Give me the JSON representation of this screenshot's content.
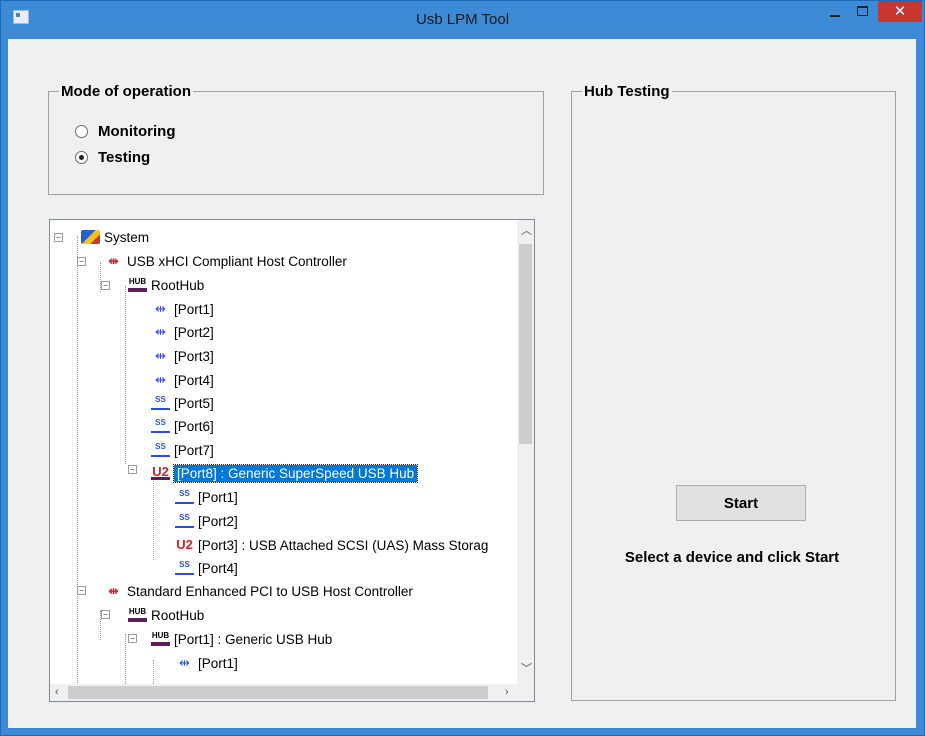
{
  "window": {
    "title": "Usb LPM Tool",
    "close_glyph": "✕",
    "titlebar_color": "#3d8ad6",
    "selection_color": "#0078d7"
  },
  "mode": {
    "group_label": "Mode of operation",
    "options": [
      {
        "label": "Monitoring",
        "selected": false
      },
      {
        "label": "Testing",
        "selected": true
      }
    ]
  },
  "tree": {
    "nodes": [
      {
        "label": "System",
        "icon": "pc-icon"
      },
      {
        "label": "USB xHCI Compliant Host Controller",
        "icon": "host-controller-icon"
      },
      {
        "label": "RootHub",
        "icon": "hub-icon"
      },
      {
        "label": "[Port1]",
        "icon": "usb-port-icon"
      },
      {
        "label": "[Port2]",
        "icon": "usb-port-icon"
      },
      {
        "label": "[Port3]",
        "icon": "usb-port-icon"
      },
      {
        "label": "[Port4]",
        "icon": "usb-port-icon"
      },
      {
        "label": "[Port5]",
        "icon": "superspeed-port-icon"
      },
      {
        "label": "[Port6]",
        "icon": "superspeed-port-icon"
      },
      {
        "label": "[Port7]",
        "icon": "superspeed-port-icon"
      },
      {
        "label": "[Port8]  :  Generic SuperSpeed USB Hub",
        "icon": "u2-hub-icon",
        "selected": true
      },
      {
        "label": "[Port1]",
        "icon": "superspeed-port-icon"
      },
      {
        "label": "[Port2]",
        "icon": "superspeed-port-icon"
      },
      {
        "label": "[Port3]  :  USB Attached SCSI (UAS) Mass Storag",
        "icon": "u2-device-icon"
      },
      {
        "label": "[Port4]",
        "icon": "superspeed-port-icon"
      },
      {
        "label": "Standard Enhanced PCI to USB Host Controller",
        "icon": "host-controller-icon"
      },
      {
        "label": "RootHub",
        "icon": "hub-icon"
      },
      {
        "label": "[Port1]  :  Generic USB Hub",
        "icon": "hub-icon"
      },
      {
        "label": "[Port1]",
        "icon": "usb-port-icon"
      }
    ]
  },
  "hub_testing": {
    "group_label": "Hub Testing",
    "start_label": "Start",
    "hint": "Select a device and click Start"
  }
}
